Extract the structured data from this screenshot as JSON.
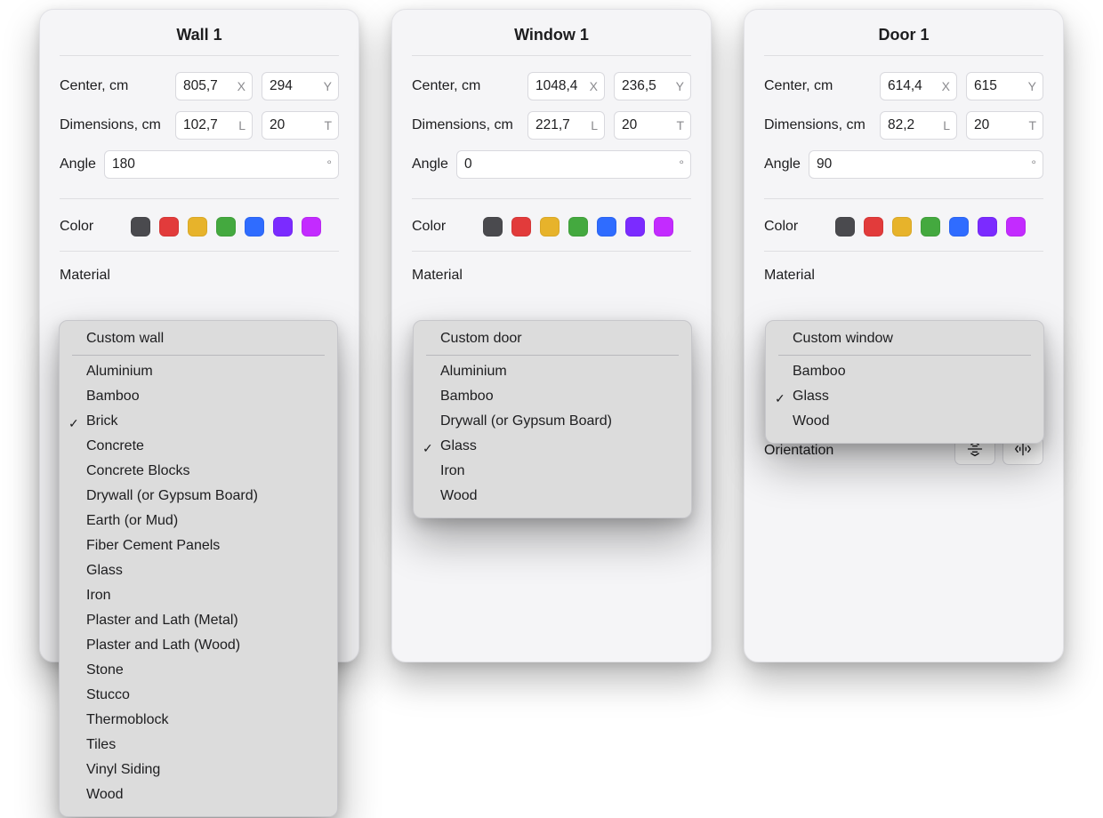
{
  "labels": {
    "center": "Center, cm",
    "dimensions": "Dimensions, cm",
    "angle": "Angle",
    "color": "Color",
    "material": "Material",
    "orientation": "Orientation",
    "unitX": "X",
    "unitY": "Y",
    "unitL": "L",
    "unitT": "T",
    "unitDeg": "°"
  },
  "colors": [
    "#4a4a4e",
    "#e23b3b",
    "#e7b32b",
    "#44a93f",
    "#2f6cff",
    "#7b2bff",
    "#c32bff"
  ],
  "panels": [
    {
      "title": "Wall 1",
      "center": {
        "x": "805,7",
        "y": "294"
      },
      "dims": {
        "l": "102,7",
        "t": "20"
      },
      "angle": "180",
      "material_menu": {
        "header": "Custom wall",
        "items": [
          {
            "label": "Aluminium"
          },
          {
            "label": "Bamboo"
          },
          {
            "label": "Brick",
            "checked": true
          },
          {
            "label": "Concrete"
          },
          {
            "label": "Concrete Blocks"
          },
          {
            "label": "Drywall (or Gypsum Board)"
          },
          {
            "label": "Earth (or Mud)"
          },
          {
            "label": "Fiber Cement Panels"
          },
          {
            "label": "Glass"
          },
          {
            "label": "Iron"
          },
          {
            "label": "Plaster and Lath (Metal)"
          },
          {
            "label": "Plaster and Lath (Wood)"
          },
          {
            "label": "Stone"
          },
          {
            "label": "Stucco"
          },
          {
            "label": "Thermoblock"
          },
          {
            "label": "Tiles"
          },
          {
            "label": "Vinyl Siding"
          },
          {
            "label": "Wood"
          }
        ]
      }
    },
    {
      "title": "Window 1",
      "center": {
        "x": "1048,4",
        "y": "236,5"
      },
      "dims": {
        "l": "221,7",
        "t": "20"
      },
      "angle": "0",
      "material_menu": {
        "header": "Custom door",
        "items": [
          {
            "label": "Aluminium"
          },
          {
            "label": "Bamboo"
          },
          {
            "label": "Drywall (or Gypsum Board)"
          },
          {
            "label": "Glass",
            "checked": true
          },
          {
            "label": "Iron"
          },
          {
            "label": "Wood"
          }
        ]
      }
    },
    {
      "title": "Door 1",
      "center": {
        "x": "614,4",
        "y": "615"
      },
      "dims": {
        "l": "82,2",
        "t": "20"
      },
      "angle": "90",
      "material_menu": {
        "header": "Custom window",
        "items": [
          {
            "label": "Bamboo"
          },
          {
            "label": "Glass",
            "checked": true
          },
          {
            "label": "Wood"
          }
        ]
      },
      "show_orientation": true
    }
  ]
}
